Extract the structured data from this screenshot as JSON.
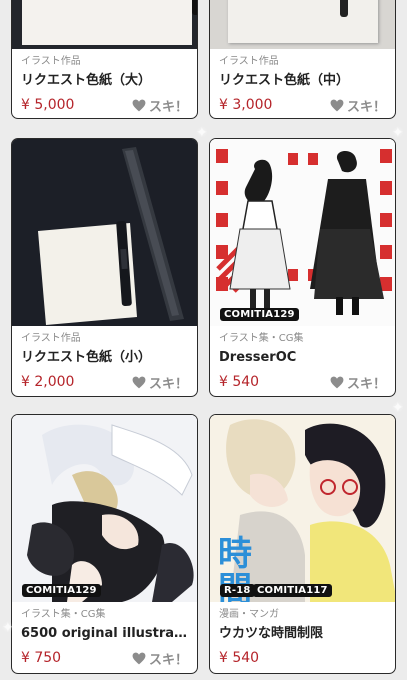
{
  "items": [
    {
      "category": "イラスト作品",
      "title": "リクエスト色紙（大）",
      "price": "¥ 5,000",
      "like": "スキ！"
    },
    {
      "category": "イラスト作品",
      "title": "リクエスト色紙（中）",
      "price": "¥ 3,000",
      "like": "スキ！"
    },
    {
      "category": "イラスト作品",
      "title": "リクエスト色紙（小）",
      "price": "¥ 2,000",
      "like": "スキ！"
    },
    {
      "category": "イラスト集・CG集",
      "title": "DresserOC",
      "price": "¥ 540",
      "like": "スキ！",
      "tags": [
        "COMITIA129"
      ]
    },
    {
      "category": "イラスト集・CG集",
      "title": "6500 original illustrati...",
      "price": "¥ 750",
      "like": "スキ！",
      "tags": [
        "COMITIA129"
      ]
    },
    {
      "category": "漫画・マンガ",
      "title": "ウカツな時間制限",
      "price": "¥ 540",
      "tags": [
        "R-18",
        "COMITIA117"
      ]
    }
  ],
  "colors": {
    "price": "#b5242a",
    "card_border": "#2a2a2a",
    "background": "#ececec"
  }
}
